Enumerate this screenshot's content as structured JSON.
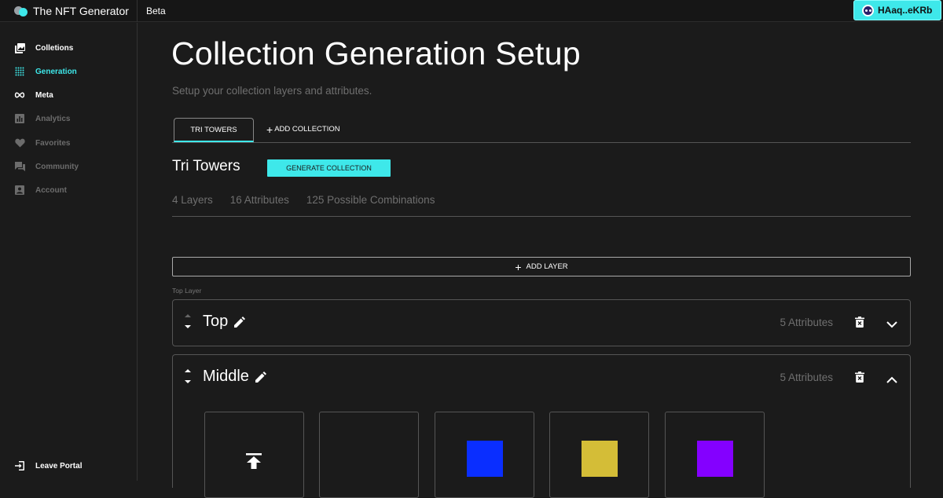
{
  "app": {
    "name": "The NFT Generator",
    "badge": "Beta"
  },
  "wallet": {
    "label": "HAaq..eKRb"
  },
  "sidebar": {
    "items": [
      {
        "label": "Colletions",
        "icon": "collections-icon",
        "state": "normal"
      },
      {
        "label": "Generation",
        "icon": "grid-icon",
        "state": "active"
      },
      {
        "label": "Meta",
        "icon": "infinity-icon",
        "state": "normal"
      },
      {
        "label": "Analytics",
        "icon": "bar-chart-icon",
        "state": "dim"
      },
      {
        "label": "Favorites",
        "icon": "heart-icon",
        "state": "dim"
      },
      {
        "label": "Community",
        "icon": "forum-icon",
        "state": "dim"
      },
      {
        "label": "Account",
        "icon": "account-icon",
        "state": "dim"
      }
    ],
    "leave": {
      "label": "Leave Portal",
      "icon": "exit-icon"
    }
  },
  "page": {
    "title": "Collection Generation Setup",
    "subtitle": "Setup your collection layers and attributes."
  },
  "tabs": {
    "active": "TRI TOWERS",
    "add": "ADD COLLECTION"
  },
  "collection": {
    "name": "Tri Towers",
    "generate_label": "GENERATE COLLECTION",
    "stats": {
      "layers": "4 Layers",
      "attributes": "16 Attributes",
      "combinations": "125 Possible Combinations"
    }
  },
  "add_layer_label": "ADD LAYER",
  "top_layer_label": "Top Layer",
  "layers": [
    {
      "name": "Top",
      "attributes": "5 Attributes",
      "expanded": false
    },
    {
      "name": "Middle",
      "attributes": "5 Attributes",
      "expanded": true,
      "tiles": [
        {
          "kind": "upload",
          "icon": "upload-icon"
        },
        {
          "kind": "empty"
        },
        {
          "kind": "color",
          "color": "#0a2eff"
        },
        {
          "kind": "color",
          "color": "#d4bd37"
        },
        {
          "kind": "color",
          "color": "#8400ff"
        }
      ]
    }
  ],
  "colors": {
    "accent": "#3ee8ea",
    "background": "#1b1b1b"
  }
}
